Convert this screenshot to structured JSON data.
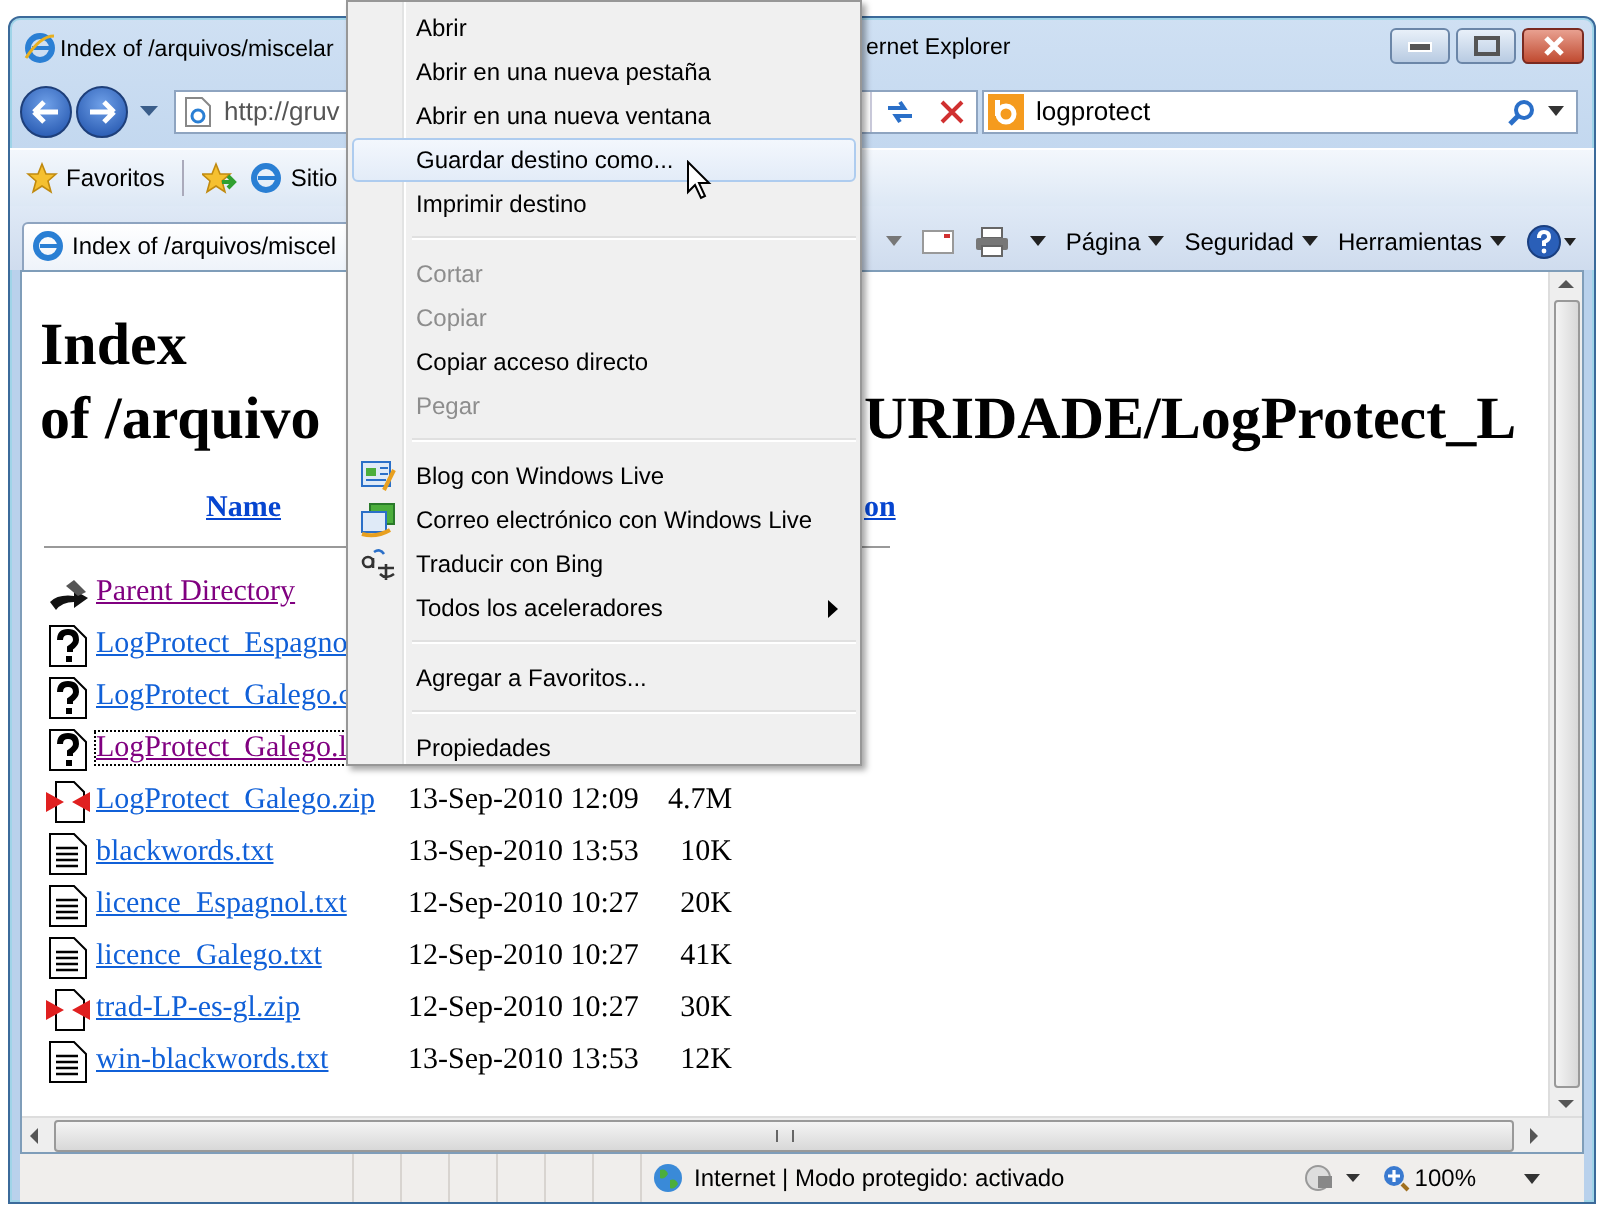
{
  "window": {
    "title_start": "Index of /arquivos/miscelar",
    "title_end": "ernet Explorer"
  },
  "address_bar": {
    "value": "http://gruv"
  },
  "search": {
    "value": "logprotect"
  },
  "favorites_bar": {
    "favorites": "Favoritos",
    "site": "Sitio"
  },
  "tab": {
    "title": "Index of /arquivos/miscel"
  },
  "command_bar": [
    "Página",
    "Seguridad",
    "Herramientas"
  ],
  "page": {
    "heading_line1": "Index",
    "heading_line2_start": "of /arquivo",
    "heading_line2_end": "URIDADE/LogProtect_L",
    "columns": [
      "Name",
      "on"
    ],
    "files": [
      {
        "kind": "parent",
        "name": "Parent Directory",
        "visited": true,
        "focused": false
      },
      {
        "kind": "unknown",
        "name": "LogProtect_Espagno",
        "visited": false,
        "focused": false
      },
      {
        "kind": "unknown",
        "name": "LogProtect_Galego.c",
        "visited": false,
        "focused": false
      },
      {
        "kind": "unknown",
        "name": "LogProtect_Galego.l",
        "visited": true,
        "focused": true
      },
      {
        "kind": "zip",
        "name": "LogProtect_Galego.zip",
        "visited": false,
        "focused": false,
        "date": "13-Sep-2010 12:09",
        "size": "4.7M"
      },
      {
        "kind": "text",
        "name": "blackwords.txt",
        "visited": false,
        "focused": false,
        "date": "13-Sep-2010 13:53",
        "size": "10K"
      },
      {
        "kind": "text",
        "name": "licence_Espagnol.txt",
        "visited": false,
        "focused": false,
        "date": "12-Sep-2010 10:27",
        "size": "20K"
      },
      {
        "kind": "text",
        "name": "licence_Galego.txt",
        "visited": false,
        "focused": false,
        "date": "12-Sep-2010 10:27",
        "size": "41K"
      },
      {
        "kind": "zip",
        "name": "trad-LP-es-gl.zip",
        "visited": false,
        "focused": false,
        "date": "12-Sep-2010 10:27",
        "size": "30K"
      },
      {
        "kind": "text",
        "name": "win-blackwords.txt",
        "visited": false,
        "focused": false,
        "date": "13-Sep-2010 13:53",
        "size": "12K"
      }
    ]
  },
  "status_bar": {
    "zone": "Internet | Modo protegido: activado",
    "zoom": "100%"
  },
  "context_menu": [
    {
      "kind": "plain",
      "label": "Abrir",
      "disabled": false,
      "selected": false
    },
    {
      "kind": "plain",
      "label": "Abrir en una nueva pestaña",
      "disabled": false,
      "selected": false
    },
    {
      "kind": "plain",
      "label": "Abrir en una nueva ventana",
      "disabled": false,
      "selected": false
    },
    {
      "kind": "plain",
      "label": "Guardar destino como...",
      "disabled": false,
      "selected": true
    },
    {
      "kind": "plain",
      "label": "Imprimir destino",
      "disabled": false,
      "selected": false
    },
    {
      "kind": "separator"
    },
    {
      "kind": "plain",
      "label": "Cortar",
      "disabled": true,
      "selected": false
    },
    {
      "kind": "plain",
      "label": "Copiar",
      "disabled": true,
      "selected": false
    },
    {
      "kind": "plain",
      "label": "Copiar acceso directo",
      "disabled": false,
      "selected": false
    },
    {
      "kind": "plain",
      "label": "Pegar",
      "disabled": true,
      "selected": false
    },
    {
      "kind": "separator"
    },
    {
      "kind": "blog",
      "label": "Blog con Windows Live",
      "disabled": false,
      "selected": false
    },
    {
      "kind": "mail",
      "label": "Correo electrónico con Windows Live",
      "disabled": false,
      "selected": false
    },
    {
      "kind": "translate",
      "label": "Traducir con Bing",
      "disabled": false,
      "selected": false
    },
    {
      "kind": "submenu",
      "label": "Todos los aceleradores",
      "disabled": false,
      "selected": false
    },
    {
      "kind": "separator"
    },
    {
      "kind": "plain",
      "label": "Agregar a Favoritos...",
      "disabled": false,
      "selected": false
    },
    {
      "kind": "separator"
    },
    {
      "kind": "plain",
      "label": "Propiedades",
      "disabled": false,
      "selected": false
    }
  ]
}
